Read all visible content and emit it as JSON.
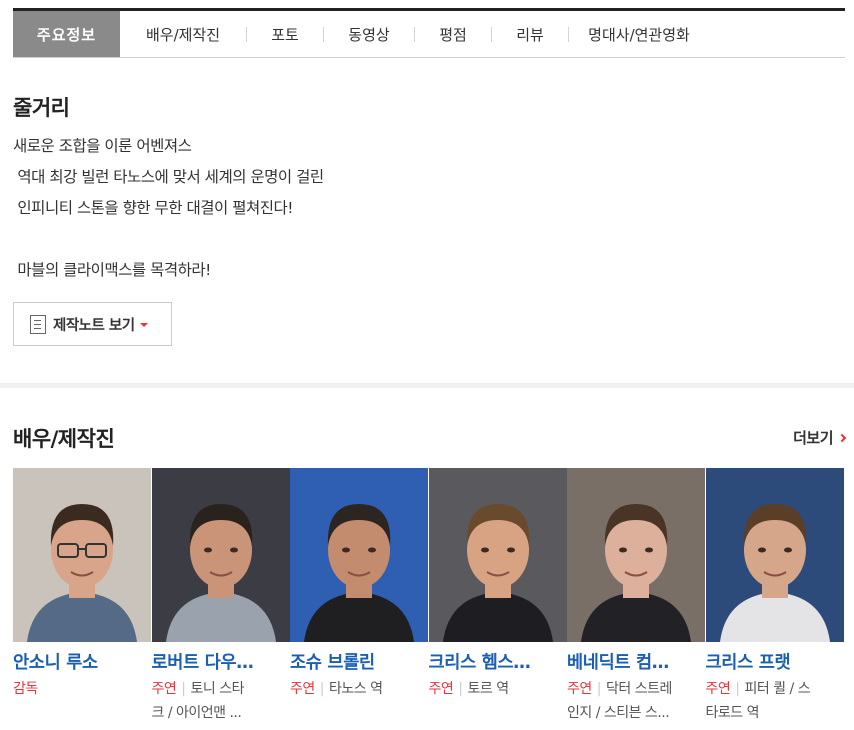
{
  "tabs": [
    {
      "label": "주요정보",
      "active": true,
      "width": 107
    },
    {
      "label": "배우/제작진",
      "width": 126
    },
    {
      "label": "포토",
      "width": 76
    },
    {
      "label": "동영상",
      "width": 90
    },
    {
      "label": "평점",
      "width": 76
    },
    {
      "label": "리뷰",
      "width": 76
    },
    {
      "label": "명대사/연관영화",
      "width": 140
    }
  ],
  "synopsis": {
    "title": "줄거리",
    "lines": [
      "새로운 조합을 이룬 어벤져스",
      " 역대 최강 빌런 타노스에 맞서 세계의 운명이 걸린",
      " 인피니티 스톤을 향한 무한 대결이 펼쳐진다!",
      "",
      " 마블의 클라이맥스를 목격하라!"
    ],
    "note_button": "제작노트 보기"
  },
  "cast_section": {
    "title": "배우/제작진",
    "more_label": "더보기",
    "members": [
      {
        "name": "안소니 루소",
        "role_type": "감독",
        "role_line1": "",
        "role_line2": "",
        "photo": {
          "bg": "#c9c3bb",
          "skin": "#d9a58a",
          "hair": "#3b2a20",
          "shirt": "#556a86",
          "glasses": true
        }
      },
      {
        "name": "로버트 다우…",
        "role_type": "주연",
        "role_line1": "토니 스타",
        "role_line2": "크 / 아이언맨 ...",
        "photo": {
          "bg": "#3c3c44",
          "skin": "#c99478",
          "hair": "#2a221d",
          "shirt": "#9aa3ad",
          "glasses": false
        }
      },
      {
        "name": "조슈 브롤린",
        "role_type": "주연",
        "role_line1": "타노스 역",
        "role_line2": "",
        "photo": {
          "bg": "#2f5fb3",
          "skin": "#c48c6e",
          "hair": "#2d2520",
          "shirt": "#1f1f22",
          "glasses": false
        }
      },
      {
        "name": "크리스 헴스…",
        "role_type": "주연",
        "role_line1": "토르 역",
        "role_line2": "",
        "photo": {
          "bg": "#5a5a5e",
          "skin": "#d7a383",
          "hair": "#6a4a2c",
          "shirt": "#1e1e22",
          "glasses": false
        }
      },
      {
        "name": "베네딕트 컴…",
        "role_type": "주연",
        "role_line1": "닥터 스트레",
        "role_line2": "인지 / 스티븐 스...",
        "photo": {
          "bg": "#7a6f66",
          "skin": "#dcb09a",
          "hair": "#4a3426",
          "shirt": "#222226",
          "glasses": false
        }
      },
      {
        "name": "크리스 프랫",
        "role_type": "주연",
        "role_line1": "피터 퀼 / 스",
        "role_line2": "타로드 역",
        "photo": {
          "bg": "#2c4a7a",
          "skin": "#d6a68a",
          "hair": "#5a3e28",
          "shirt": "#e4e4e6",
          "glasses": false
        }
      }
    ]
  },
  "colors": {
    "accent": "#e8343a",
    "link": "#1a5fb4",
    "active_tab": "#8a8a8a"
  }
}
